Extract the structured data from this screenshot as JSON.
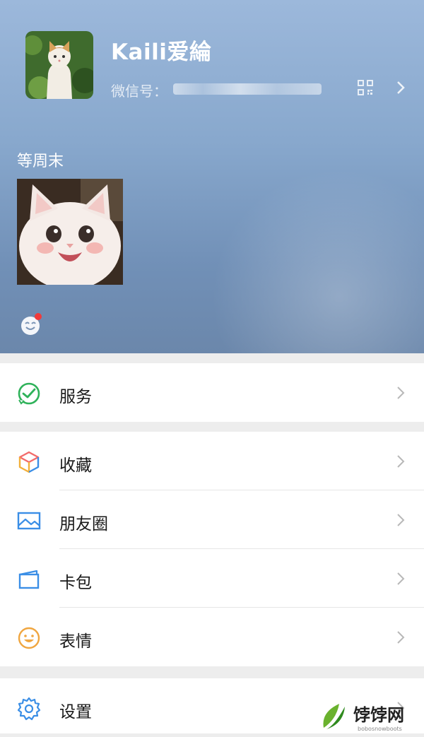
{
  "profile": {
    "name": "Kaili爱綸",
    "wechat_id_label": "微信号：",
    "status_text": "等周末"
  },
  "menu": {
    "services": {
      "label": "服务",
      "icon": "services-icon"
    },
    "favorites": {
      "label": "收藏",
      "icon": "favorites-icon"
    },
    "moments": {
      "label": "朋友圈",
      "icon": "moments-icon"
    },
    "cards": {
      "label": "卡包",
      "icon": "card-wallet-icon"
    },
    "stickers": {
      "label": "表情",
      "icon": "stickers-icon"
    },
    "settings": {
      "label": "设置",
      "icon": "gear-icon"
    }
  },
  "colors": {
    "services_green": "#2fb25a",
    "moments_blue": "#3a8ee6",
    "stickers_orange": "#f0a640",
    "badge_red": "#f23a3a"
  },
  "watermark": {
    "brand": "饽饽网",
    "site": "bobosnowboots"
  }
}
